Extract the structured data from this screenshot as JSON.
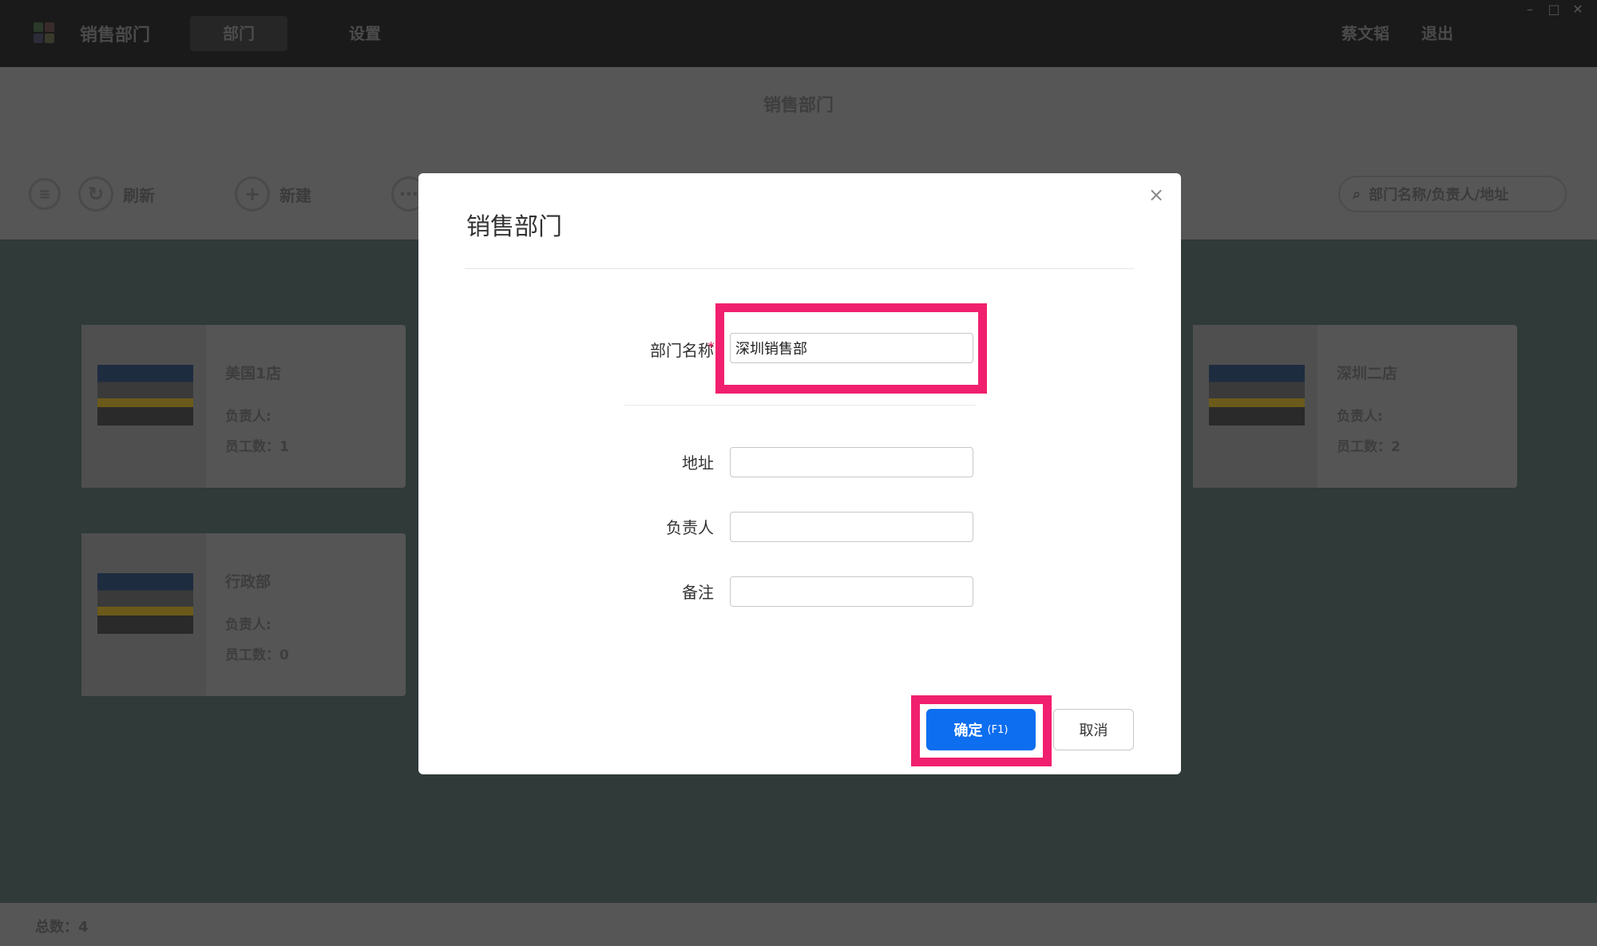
{
  "app": {
    "title": "销售部门",
    "nav_tabs": [
      {
        "label": "部门",
        "active": true
      },
      {
        "label": "设置",
        "active": false
      }
    ],
    "user_name": "蔡文韬",
    "logout_label": "退出"
  },
  "page": {
    "title": "销售部门",
    "toolbar": {
      "refresh_label": "刷新",
      "new_label": "新建"
    },
    "search_placeholder": "部门名称/负责人/地址"
  },
  "departments": [
    {
      "name": "美国1店",
      "manager_label": "负责人:",
      "employees_label": "员工数：1"
    },
    {
      "name": "深圳二店",
      "manager_label": "负责人:",
      "employees_label": "员工数：2"
    },
    {
      "name": "行政部",
      "manager_label": "负责人:",
      "employees_label": "员工数：0"
    }
  ],
  "footer": {
    "total_label": "总数：4"
  },
  "dialog": {
    "title": "销售部门",
    "close_icon": "×",
    "fields": {
      "name": {
        "label": "部门名称",
        "required_mark": "*",
        "value": "深圳销售部"
      },
      "address": {
        "label": "地址",
        "value": ""
      },
      "manager": {
        "label": "负责人",
        "value": ""
      },
      "remark": {
        "label": "备注",
        "value": ""
      }
    },
    "confirm_label": "确定",
    "confirm_hint": "(F1)",
    "cancel_label": "取消"
  },
  "colors": {
    "accent": "#0d6ef0",
    "highlight": "#f0206e",
    "overlay_bg": "#2f3a39"
  }
}
